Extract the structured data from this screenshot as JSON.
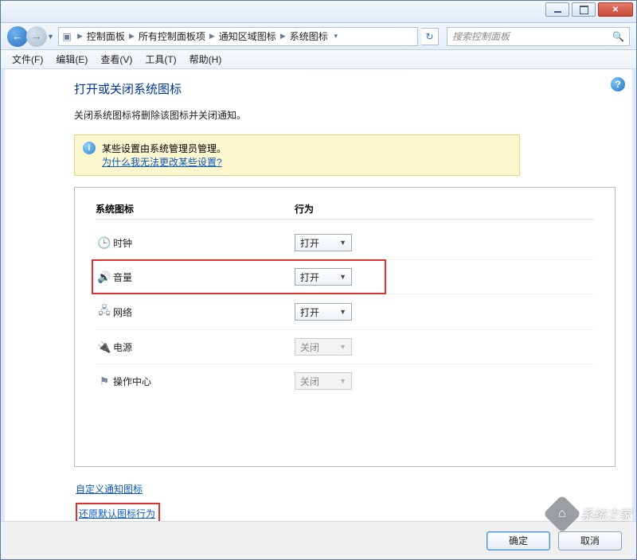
{
  "titlebar": {
    "min_tip": "最小化",
    "max_tip": "最大化",
    "close_tip": "关闭"
  },
  "breadcrumb": {
    "items": [
      "控制面板",
      "所有控制面板项",
      "通知区域图标",
      "系统图标"
    ]
  },
  "search": {
    "placeholder": "搜索控制面板"
  },
  "menu": {
    "file": "文件(F)",
    "edit": "编辑(E)",
    "view": "查看(V)",
    "tools": "工具(T)",
    "help": "帮助(H)"
  },
  "page": {
    "title": "打开或关闭系统图标",
    "desc": "关闭系统图标将删除该图标并关闭通知。",
    "admin_line": "某些设置由系统管理员管理。",
    "admin_link": "为什么我无法更改某些设置?"
  },
  "columns": {
    "icon": "系统图标",
    "behavior": "行为"
  },
  "dropdown_values": {
    "open": "打开",
    "close": "关闭"
  },
  "rows": [
    {
      "icon": "clock-icon",
      "label": "时钟",
      "value_key": "open",
      "disabled": false,
      "highlight": false
    },
    {
      "icon": "volume-icon",
      "label": "音量",
      "value_key": "open",
      "disabled": false,
      "highlight": true
    },
    {
      "icon": "network-icon",
      "label": "网络",
      "value_key": "open",
      "disabled": false,
      "highlight": false
    },
    {
      "icon": "power-icon",
      "label": "电源",
      "value_key": "close",
      "disabled": true,
      "highlight": false
    },
    {
      "icon": "action-center-icon",
      "label": "操作中心",
      "value_key": "close",
      "disabled": true,
      "highlight": false
    }
  ],
  "links": {
    "customize": "自定义通知图标",
    "restore": "还原默认图标行为"
  },
  "footer": {
    "ok": "确定",
    "cancel": "取消"
  },
  "watermark": "系统之家"
}
